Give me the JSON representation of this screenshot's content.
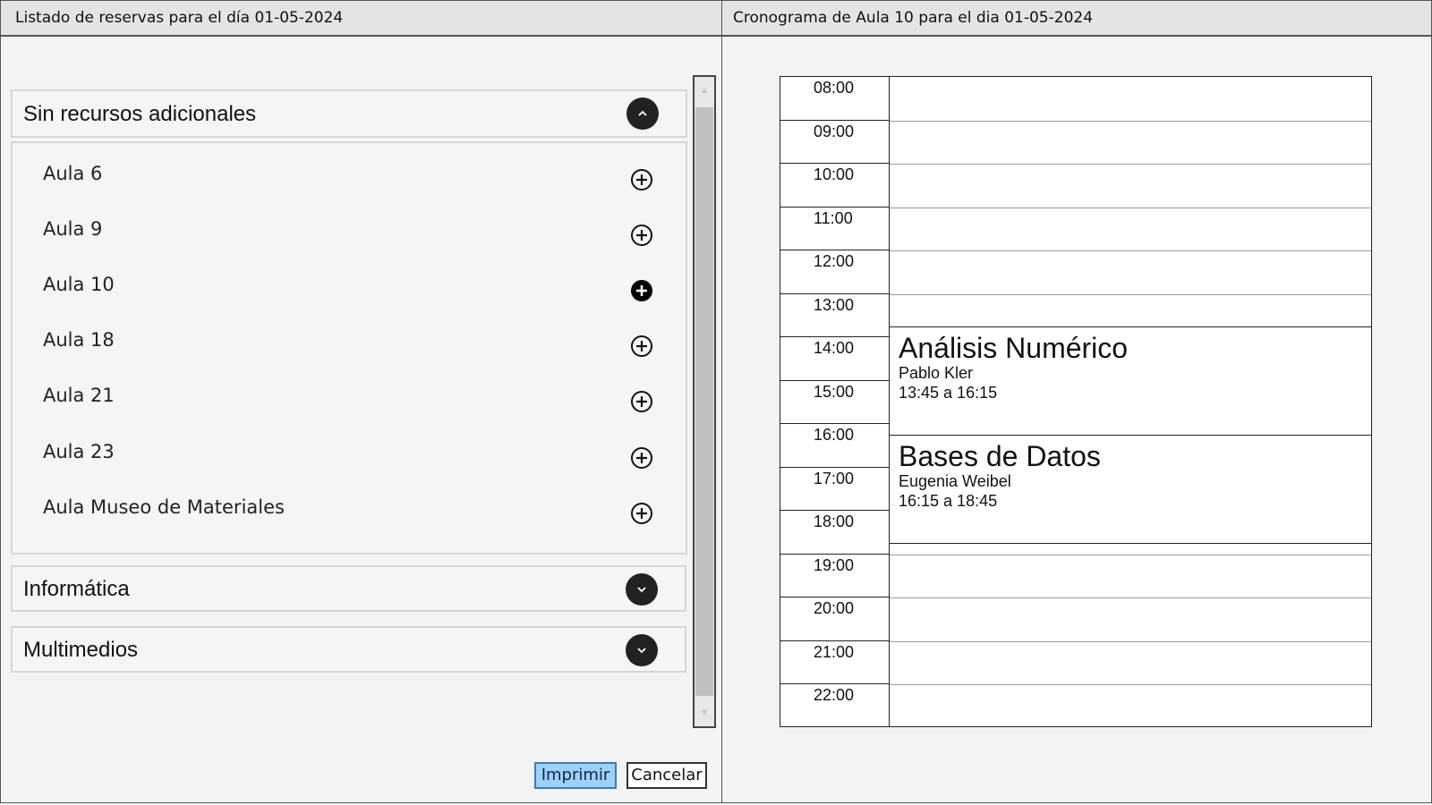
{
  "left_panel": {
    "title": "Listado de reservas para el día 01-05-2024",
    "groups": [
      {
        "label": "Sin recursos adicionales",
        "expanded": true,
        "rooms": [
          {
            "label": "Aula 6",
            "selected": false
          },
          {
            "label": "Aula 9",
            "selected": false
          },
          {
            "label": "Aula 10",
            "selected": true
          },
          {
            "label": "Aula 18",
            "selected": false
          },
          {
            "label": "Aula 21",
            "selected": false
          },
          {
            "label": "Aula 23",
            "selected": false
          },
          {
            "label": "Aula Museo de Materiales",
            "selected": false
          }
        ]
      },
      {
        "label": "Informática",
        "expanded": false
      },
      {
        "label": "Multimedios",
        "expanded": false
      }
    ],
    "buttons": {
      "print": "Imprimir",
      "cancel": "Cancelar"
    }
  },
  "right_panel": {
    "title": "Cronograma de Aula 10 para el dia 01-05-2024",
    "hours": [
      "08:00",
      "09:00",
      "10:00",
      "11:00",
      "12:00",
      "13:00",
      "14:00",
      "15:00",
      "16:00",
      "17:00",
      "18:00",
      "19:00",
      "20:00",
      "21:00",
      "22:00"
    ],
    "events": [
      {
        "title": "Análisis Numérico",
        "teacher": "Pablo Kler",
        "time": "13:45 a 16:15",
        "start": "13:45",
        "end": "16:15"
      },
      {
        "title": "Bases de Datos",
        "teacher": "Eugenia Weibel",
        "time": "16:15 a 18:45",
        "start": "16:15",
        "end": "18:45"
      }
    ]
  },
  "colors": {
    "print_button": "#9fd0f7",
    "toggle_button": "#222222",
    "border": "#555555"
  }
}
